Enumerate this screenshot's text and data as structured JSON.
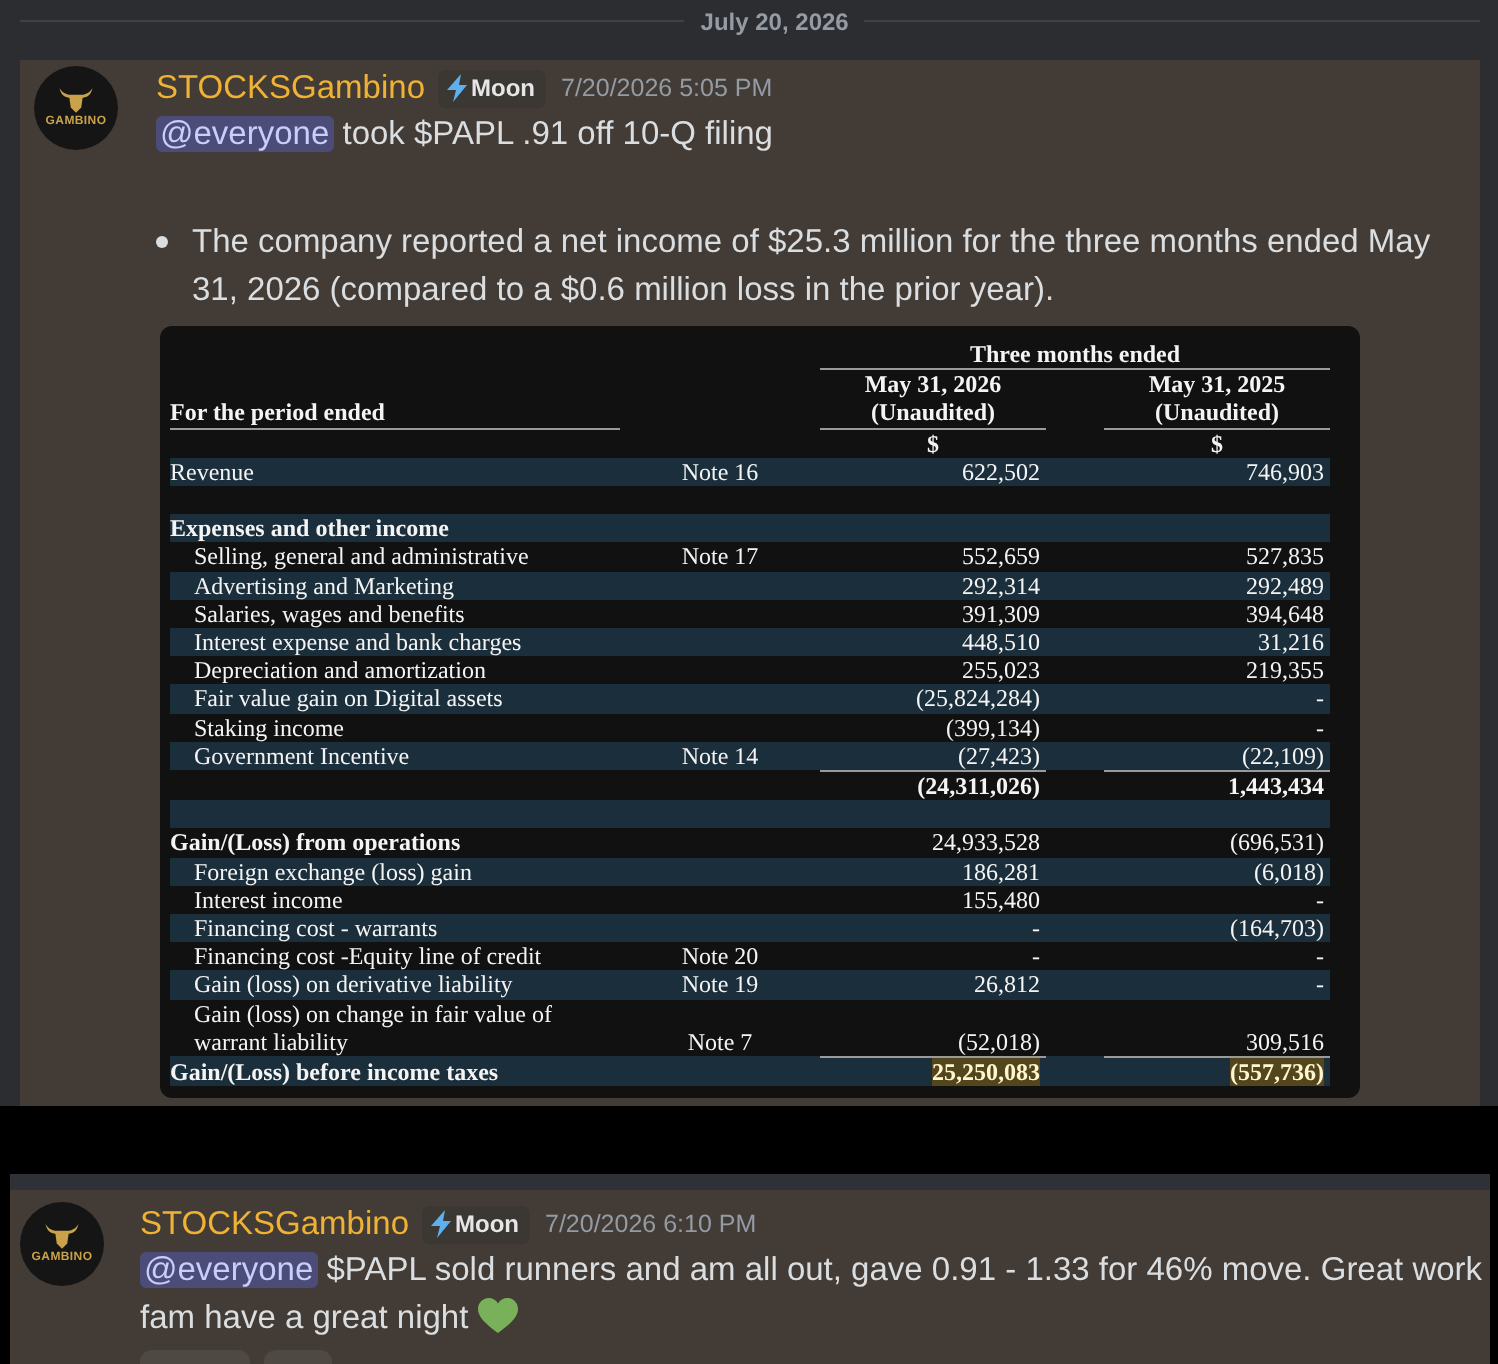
{
  "panels": [
    {
      "date_divider": "July 20, 2026",
      "messages": [
        {
          "highlighted": true,
          "author": "STOCKSGambino",
          "avatar_text": "GAMBINO",
          "role_badge": "Moon",
          "timestamp": "7/20/2026 5:05 PM",
          "content": [
            {
              "kind": "mention",
              "text": "@everyone"
            },
            {
              "kind": "text",
              "text": "took $PAPL .91 off 10-Q filing"
            }
          ],
          "bullets": [
            "The company reported a net income of $25.3 million for the three months ended May 31, 2026 (compared to a $0.6 million loss in the prior year)."
          ],
          "table": {
            "group_header": "Three months ended",
            "period_label": "For the period ended",
            "columns": [
              {
                "date": "May 31, 2026",
                "status": "(Unaudited)",
                "currency": "$"
              },
              {
                "date": "May 31, 2025",
                "status": "(Unaudited)",
                "currency": "$"
              }
            ],
            "rows": [
              {
                "kind": "plain",
                "label": "Revenue",
                "note": "Note 16",
                "values": [
                  "622,502",
                  "746,903"
                ]
              },
              {
                "kind": "blank"
              },
              {
                "kind": "heading",
                "label": "Expenses and other income"
              },
              {
                "kind": "indented",
                "label": "Selling, general and administrative",
                "note": "Note 17",
                "values": [
                  "552,659",
                  "527,835"
                ]
              },
              {
                "kind": "indented",
                "label": "Advertising and Marketing",
                "values": [
                  "292,314",
                  "292,489"
                ]
              },
              {
                "kind": "indented",
                "label": "Salaries, wages and benefits",
                "values": [
                  "391,309",
                  "394,648"
                ]
              },
              {
                "kind": "indented",
                "label": "Interest expense and bank charges",
                "values": [
                  "448,510",
                  "31,216"
                ]
              },
              {
                "kind": "indented",
                "label": "Depreciation and amortization",
                "values": [
                  "255,023",
                  "219,355"
                ]
              },
              {
                "kind": "indented",
                "label": "Fair value gain on Digital assets",
                "values": [
                  "(25,824,284)",
                  "-"
                ]
              },
              {
                "kind": "indented",
                "label": "Staking income",
                "values": [
                  "(399,134)",
                  "-"
                ]
              },
              {
                "kind": "indented",
                "label": "Government Incentive",
                "note": "Note 14",
                "values": [
                  "(27,423)",
                  "(22,109)"
                ]
              },
              {
                "kind": "subtotal",
                "values": [
                  "(24,311,026)",
                  "1,443,434"
                ]
              },
              {
                "kind": "blank"
              },
              {
                "kind": "bold_label",
                "label": "Gain/(Loss) from operations",
                "values": [
                  "24,933,528",
                  "(696,531)"
                ]
              },
              {
                "kind": "indented",
                "label": "Foreign exchange (loss) gain",
                "values": [
                  "186,281",
                  "(6,018)"
                ]
              },
              {
                "kind": "indented",
                "label": "Interest income",
                "values": [
                  "155,480",
                  "-"
                ]
              },
              {
                "kind": "indented",
                "label": "Financing cost - warrants",
                "values": [
                  "-",
                  "(164,703)"
                ]
              },
              {
                "kind": "indented",
                "label": "Financing cost -Equity line of credit",
                "note": "Note 20",
                "values": [
                  "-",
                  "-"
                ]
              },
              {
                "kind": "indented",
                "label": "Gain (loss) on derivative liability",
                "note": "Note 19",
                "values": [
                  "26,812",
                  "-"
                ]
              },
              {
                "kind": "indented",
                "label": "Gain (loss) on change in fair value of warrant liability",
                "note": "Note 7",
                "values": [
                  "(52,018)",
                  "309,516"
                ]
              },
              {
                "kind": "grand_total",
                "label": "Gain/(Loss) before income taxes",
                "values": [
                  "25,250,083",
                  "(557,736)"
                ]
              }
            ]
          }
        }
      ]
    },
    {
      "messages": [
        {
          "highlighted": true,
          "author": "STOCKSGambino",
          "avatar_text": "GAMBINO",
          "role_badge": "Moon",
          "timestamp": "7/20/2026 6:10 PM",
          "content": [
            {
              "kind": "mention",
              "text": "@everyone"
            },
            {
              "kind": "text",
              "text": "$PAPL sold runners and am all out, gave 0.91 - 1.33 for 46% move. Great work fam have a great night"
            },
            {
              "kind": "emoji"
            }
          ],
          "reactions": [
            {
              "kind": "wide"
            },
            {
              "kind": "narrow"
            }
          ]
        }
      ]
    }
  ]
}
